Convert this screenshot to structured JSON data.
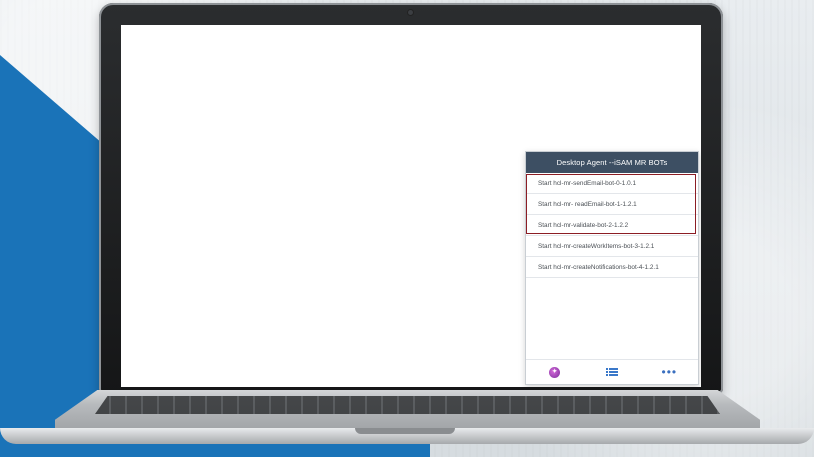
{
  "agent": {
    "title": "Desktop Agent --iSAM MR BOTs",
    "bots": [
      {
        "label": "Start hcl-mr-sendEmail-bot-0-1.0.1"
      },
      {
        "label": "Start hcl-mr- readEmail-bot-1-1.2.1"
      },
      {
        "label": "Start hcl-mr-validate-bot-2-1.2.2"
      },
      {
        "label": "Start hcl-mr-createWorkItems-bot-3-1.2.1"
      },
      {
        "label": "Start hcl-mr-createNotifications-bot-4-1.2.1"
      }
    ],
    "footer_icons": [
      "app-logo-icon",
      "list-icon",
      "more-icon"
    ],
    "highlight_color": "#8c1d24",
    "header_color": "#3d4f63"
  },
  "background": {
    "accent_color": "#1a73b8"
  }
}
